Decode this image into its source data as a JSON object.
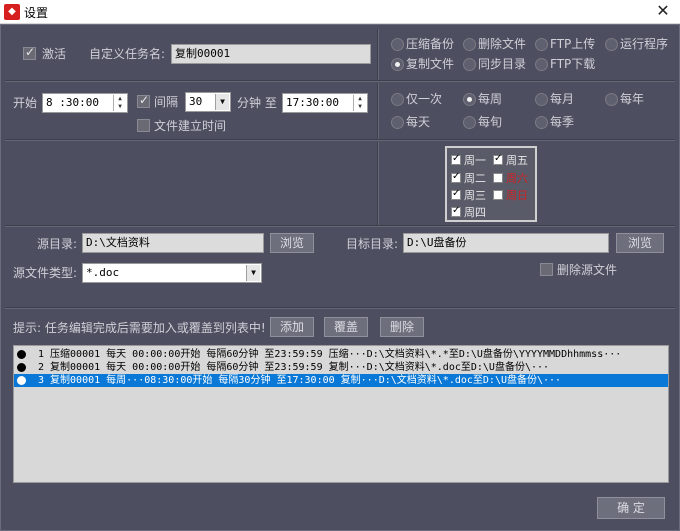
{
  "window": {
    "title": "设置",
    "app_icon": "app-icon-red",
    "close_label": "✕"
  },
  "task": {
    "activate_label": "激活",
    "activate_checked": true,
    "name_label": "自定义任务名:",
    "name_value": "复制00001"
  },
  "operation": {
    "options": [
      {
        "label": "压缩备份",
        "checked": false
      },
      {
        "label": "删除文件",
        "checked": false
      },
      {
        "label": "FTP上传",
        "checked": false
      },
      {
        "label": "运行程序",
        "checked": false
      },
      {
        "label": "复制文件",
        "checked": true
      },
      {
        "label": "同步目录",
        "checked": false
      },
      {
        "label": "FTP下载",
        "checked": false
      }
    ]
  },
  "timing": {
    "start_label": "开始",
    "start_value": "8 :30:00",
    "interval_label": "间隔",
    "interval_checked": true,
    "interval_value": "30",
    "minute_label": "分钟 至",
    "end_value": "17:30:00",
    "file_time_label": "文件建立时间",
    "file_time_checked": false
  },
  "frequency": {
    "options": [
      {
        "label": "仅一次",
        "checked": false
      },
      {
        "label": "每周",
        "checked": true
      },
      {
        "label": "每月",
        "checked": false
      },
      {
        "label": "每年",
        "checked": false
      },
      {
        "label": "每天",
        "checked": false
      },
      {
        "label": "每旬",
        "checked": false
      },
      {
        "label": "每季",
        "checked": false
      }
    ]
  },
  "weekdays": [
    {
      "label": "周一",
      "checked": true,
      "red": false
    },
    {
      "label": "周二",
      "checked": true,
      "red": false
    },
    {
      "label": "周三",
      "checked": true,
      "red": false
    },
    {
      "label": "周四",
      "checked": true,
      "red": false
    },
    {
      "label": "周五",
      "checked": true,
      "red": false
    },
    {
      "label": "周六",
      "checked": false,
      "red": true
    },
    {
      "label": "周日",
      "checked": false,
      "red": true
    }
  ],
  "paths": {
    "source_label": "源目录:",
    "source_value": "D:\\文档资料",
    "browse_label": "浏览",
    "target_label": "目标目录:",
    "target_value": "D:\\U盘备份",
    "filetype_label": "源文件类型:",
    "filetype_value": "*.doc",
    "delete_source_label": "删除源文件",
    "delete_source_checked": false
  },
  "hint": {
    "text": "提示: 任务编辑完成后需要加入或覆盖到列表中!",
    "add_label": "添加",
    "overwrite_label": "覆盖",
    "delete_label": "删除"
  },
  "task_list": [
    {
      "text": "1 压缩00001  每天  00:00:00开始 每隔60分钟 至23:59:59 压缩···D:\\文档资料\\*.*至D:\\U盘备份\\YYYYMMDDhhmmss···",
      "selected": false
    },
    {
      "text": "2 复制00001  每天  00:00:00开始 每隔60分钟 至23:59:59 复制···D:\\文档资料\\*.doc至D:\\U盘备份\\···",
      "selected": false
    },
    {
      "text": "3 复制00001 每周···08:30:00开始 每隔30分钟 至17:30:00 复制···D:\\文档资料\\*.doc至D:\\U盘备份\\···",
      "selected": true
    }
  ],
  "confirm_label": "确 定",
  "colors": {
    "background": "#4d4e5f",
    "text": "#d0d0d8",
    "selection": "#0a78d6",
    "weekend_red": "#cc2222"
  }
}
